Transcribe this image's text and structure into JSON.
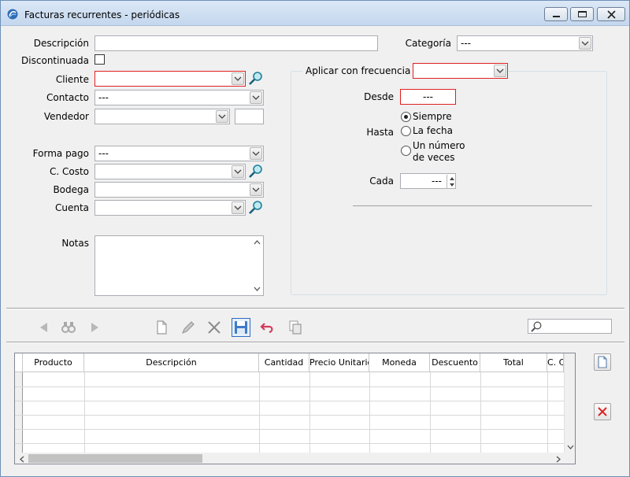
{
  "window": {
    "title": "Facturas recurrentes - periódicas"
  },
  "form": {
    "descripcion_label": "Descripción",
    "descripcion_value": "",
    "categoria_label": "Categoría",
    "categoria_value": "---",
    "discontinuada_label": "Discontinuada",
    "cliente_label": "Cliente",
    "cliente_value": "",
    "contacto_label": "Contacto",
    "contacto_value": "---",
    "vendedor_label": "Vendedor",
    "vendedor_value": "",
    "forma_pago_label": "Forma pago",
    "forma_pago_value": "---",
    "c_costo_label": "C. Costo",
    "c_costo_value": "",
    "bodega_label": "Bodega",
    "bodega_value": "",
    "cuenta_label": "Cuenta",
    "cuenta_value": "",
    "notas_label": "Notas"
  },
  "frecuencia": {
    "aplicar_label": "Aplicar con frecuencia",
    "aplicar_value": "",
    "desde_label": "Desde",
    "desde_value": "---",
    "hasta_label": "Hasta",
    "hasta_siempre": "Siempre",
    "hasta_fecha": "La fecha",
    "hasta_numero_1": "Un número",
    "hasta_numero_2": "de veces",
    "cada_label": "Cada",
    "cada_value": "---"
  },
  "grid": {
    "columns": [
      "Producto",
      "Descripción",
      "Cantidad",
      "Precio Unitario C",
      "Moneda",
      "Descuento",
      "Total",
      "C. C"
    ]
  },
  "colors": {
    "title_gradient_top": "#dbe8f6",
    "required_border": "#e02020",
    "highlight_blue": "#2d6bbd",
    "delete_red": "#e02020"
  }
}
